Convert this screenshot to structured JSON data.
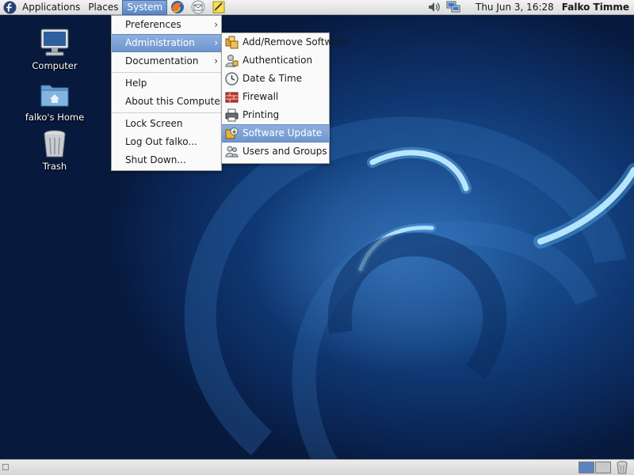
{
  "top_panel": {
    "menus": {
      "applications": "Applications",
      "places": "Places",
      "system": "System"
    },
    "clock": "Thu Jun  3, 16:28",
    "user": "Falko Timme",
    "launchers": [
      "firefox-icon",
      "mail-icon",
      "notes-icon"
    ],
    "tray": [
      "volume-icon",
      "network-icon"
    ]
  },
  "desktop": {
    "icons": [
      {
        "label": "Computer",
        "icon": "computer-icon"
      },
      {
        "label": "falko's Home",
        "icon": "home-folder-icon"
      },
      {
        "label": "Trash",
        "icon": "trash-icon"
      }
    ]
  },
  "system_menu": {
    "items": [
      {
        "label": "Preferences",
        "submenu": true
      },
      {
        "label": "Administration",
        "submenu": true,
        "highlighted": true
      },
      {
        "label": "Documentation",
        "submenu": true
      },
      {
        "label": "Help"
      },
      {
        "label": "About this Computer"
      },
      {
        "label": "Lock Screen"
      },
      {
        "label": "Log Out falko..."
      },
      {
        "label": "Shut Down..."
      }
    ],
    "arrow": "›"
  },
  "administration_menu": {
    "items": [
      {
        "label": "Add/Remove Software",
        "icon": "package-icon"
      },
      {
        "label": "Authentication",
        "icon": "authentication-icon"
      },
      {
        "label": "Date & Time",
        "icon": "clock-icon"
      },
      {
        "label": "Firewall",
        "icon": "firewall-icon"
      },
      {
        "label": "Printing",
        "icon": "printer-icon"
      },
      {
        "label": "Software Update",
        "icon": "software-update-icon",
        "highlighted": true
      },
      {
        "label": "Users and Groups",
        "icon": "users-icon"
      }
    ]
  },
  "bottom_panel": {
    "workspaces": [
      "workspace-1",
      "workspace-2"
    ],
    "active_workspace": 1
  },
  "colors": {
    "highlight": "#6e95cf",
    "wallpaper": "#174a8a"
  }
}
